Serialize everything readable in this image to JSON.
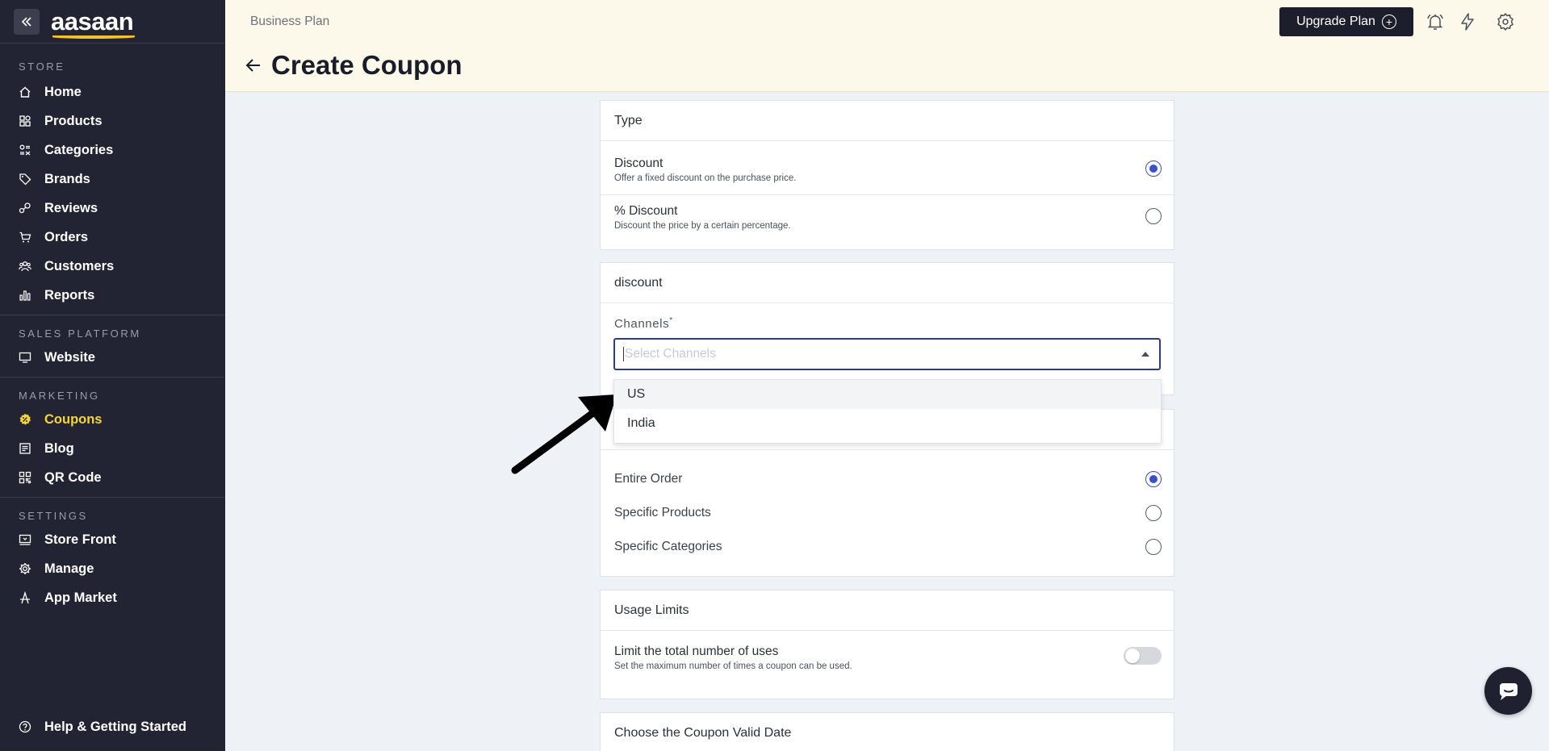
{
  "sidebar": {
    "logo": "aasaan",
    "sections": {
      "store": "STORE",
      "sales_platform": "SALES PLATFORM",
      "marketing": "MARKETING",
      "settings": "SETTINGS"
    },
    "store_items": [
      {
        "label": "Home",
        "icon": "home-icon"
      },
      {
        "label": "Products",
        "icon": "products-icon"
      },
      {
        "label": "Categories",
        "icon": "categories-icon"
      },
      {
        "label": "Brands",
        "icon": "tag-icon"
      },
      {
        "label": "Reviews",
        "icon": "reviews-icon"
      },
      {
        "label": "Orders",
        "icon": "cart-icon"
      },
      {
        "label": "Customers",
        "icon": "users-icon"
      },
      {
        "label": "Reports",
        "icon": "bar-chart-icon"
      }
    ],
    "sales_items": [
      {
        "label": "Website",
        "icon": "monitor-icon"
      }
    ],
    "marketing_items": [
      {
        "label": "Coupons",
        "icon": "coupon-icon",
        "active": true
      },
      {
        "label": "Blog",
        "icon": "blog-icon"
      },
      {
        "label": "QR Code",
        "icon": "qr-icon"
      }
    ],
    "settings_items": [
      {
        "label": "Store Front",
        "icon": "storefront-icon"
      },
      {
        "label": "Manage",
        "icon": "gear-icon"
      },
      {
        "label": "App Market",
        "icon": "app-market-icon"
      }
    ],
    "help": "Help & Getting Started"
  },
  "header": {
    "breadcrumb": "Business Plan",
    "title": "Create Coupon",
    "upgrade_label": "Upgrade Plan"
  },
  "type_card": {
    "heading": "Type",
    "options": [
      {
        "title": "Discount",
        "subtitle": "Offer a fixed discount on the purchase price.",
        "selected": true
      },
      {
        "title": "% Discount",
        "subtitle": "Discount the price by a certain percentage.",
        "selected": false
      }
    ]
  },
  "discount_card": {
    "heading": "discount",
    "channels_label": "Channels",
    "required_mark": "*",
    "placeholder": "Select Channels",
    "options": [
      "US",
      "India"
    ]
  },
  "applies_card": {
    "options": [
      {
        "label": "Entire Order",
        "selected": true
      },
      {
        "label": "Specific Products",
        "selected": false
      },
      {
        "label": "Specific Categories",
        "selected": false
      }
    ]
  },
  "usage_card": {
    "heading": "Usage Limits",
    "limit_title": "Limit the total number of uses",
    "limit_subtitle": "Set the maximum number of times a coupon can be used.",
    "limit_enabled": false
  },
  "date_card": {
    "heading": "Choose the Coupon Valid Date"
  },
  "colors": {
    "sidebar_bg": "#232433",
    "active_item": "#f6d53a",
    "topbar_bg": "#fdf9ea",
    "radio_accent": "#3a4fc9",
    "select_border": "#2e3b8a"
  }
}
